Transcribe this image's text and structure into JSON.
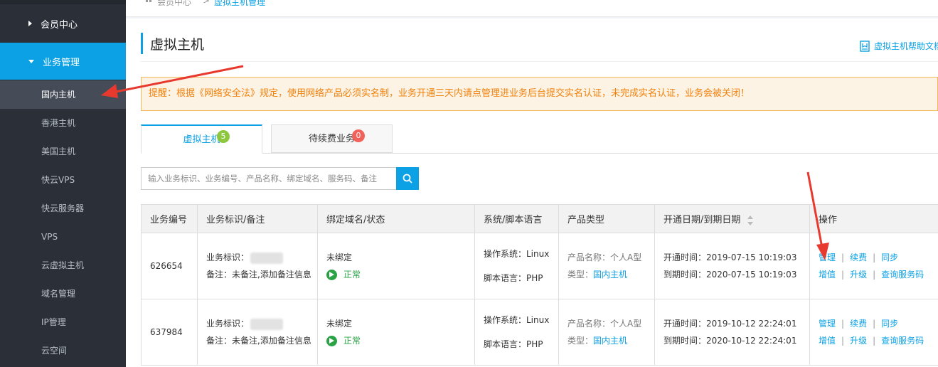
{
  "sidebar": {
    "group_member": "会员中心",
    "group_business": "业务管理",
    "items": [
      {
        "label": "国内主机",
        "active": true
      },
      {
        "label": "香港主机"
      },
      {
        "label": "美国主机"
      },
      {
        "label": "快云VPS"
      },
      {
        "label": "快云服务器"
      },
      {
        "label": "VPS"
      },
      {
        "label": "云虚拟主机"
      },
      {
        "label": "域名管理"
      },
      {
        "label": "IP管理"
      },
      {
        "label": "云空间"
      }
    ]
  },
  "breadcrumb": {
    "home": "会员中心",
    "separator": ">",
    "current": "虚拟主机管理"
  },
  "page": {
    "title": "虚拟主机",
    "help_link": "虚拟主机帮助文档"
  },
  "notice": "提醒：根据《网络安全法》规定，使用网络产品必须实名制，业务开通三天内请点管理进业务后台提交实名认证，未完成实名认证，业务会被关闭！",
  "tabs": [
    {
      "label": "虚拟主机",
      "badge": "5"
    },
    {
      "label": "待续费业务",
      "badge": "0"
    }
  ],
  "search": {
    "placeholder": "输入业务标识、业务编号、产品名称、绑定域名、服务码、备注"
  },
  "table": {
    "headers": [
      "业务编号",
      "业务标识/备注",
      "绑定域名/状态",
      "系统/脚本语言",
      "产品类型",
      "开通日期/到期日期",
      "操作"
    ],
    "rows": [
      {
        "id": "626654",
        "ident_label": "业务标识：",
        "note": "备注：未备注,添加备注信息",
        "domain": "未绑定",
        "status": "正常",
        "os": "操作系统：Linux",
        "script": "脚本语言：PHP",
        "product_name": "产品名称：个人A型",
        "type_label": "类型：",
        "type_value": "国内主机",
        "open": "开通时间：2019-07-15 10:19:03",
        "expire": "到期时间：2020-07-15 10:19:03",
        "ops": [
          "管理",
          "续费",
          "同步",
          "增值",
          "升级",
          "查询服务码"
        ]
      },
      {
        "id": "637984",
        "ident_label": "业务标识：",
        "note": "备注：未备注,添加备注信息",
        "domain": "未绑定",
        "status": "正常",
        "os": "操作系统：Linux",
        "script": "脚本语言：PHP",
        "product_name": "产品名称：个人A型",
        "type_label": "类型：",
        "type_value": "国内主机",
        "open": "开通时间：2019-10-12 22:24:01",
        "expire": "到期时间：2020-10-12 22:24:01",
        "ops": [
          "管理",
          "续费",
          "同步",
          "增值",
          "升级",
          "查询服务码"
        ]
      }
    ]
  },
  "colors": {
    "accent": "#0ba1e4",
    "annotation_arrow": "#e8392f",
    "status_ok": "#2ba245"
  }
}
